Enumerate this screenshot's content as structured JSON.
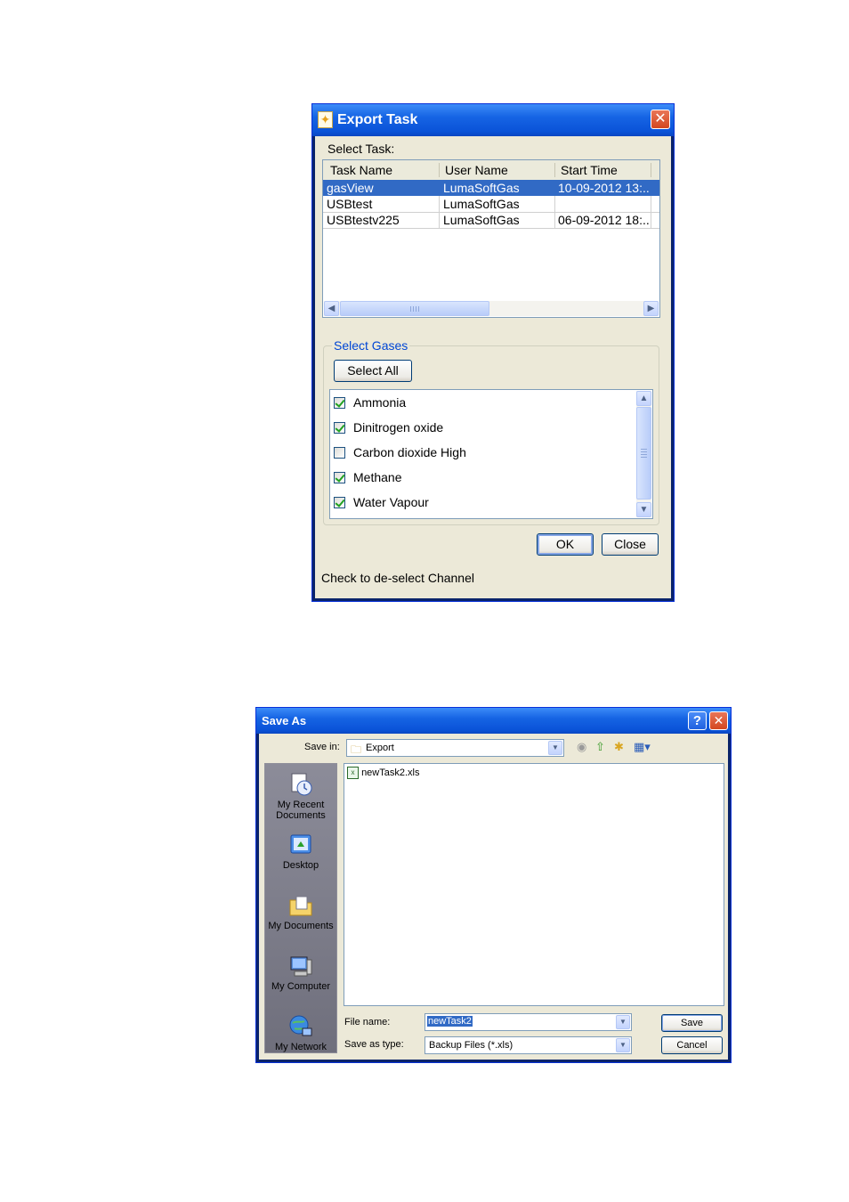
{
  "export_dialog": {
    "title": "Export Task",
    "select_task_label": "Select Task:",
    "columns": [
      "Task Name",
      "User Name",
      "Start Time"
    ],
    "tasks": [
      {
        "name": "gasView",
        "user": "LumaSoftGas",
        "start": "10-09-2012 13:...",
        "selected": true
      },
      {
        "name": "USBtest",
        "user": "LumaSoftGas",
        "start": "",
        "selected": false
      },
      {
        "name": "USBtestv225",
        "user": "LumaSoftGas",
        "start": "06-09-2012 18:...",
        "selected": false
      }
    ],
    "gases_group": "Select Gases",
    "select_all_label": "Select All",
    "gases": [
      {
        "label": "Ammonia",
        "checked": true
      },
      {
        "label": "Dinitrogen oxide",
        "checked": true
      },
      {
        "label": "Carbon dioxide High",
        "checked": false
      },
      {
        "label": "Methane",
        "checked": true
      },
      {
        "label": "Water Vapour",
        "checked": true
      }
    ],
    "ok_label": "OK",
    "close_label": "Close",
    "status_text": "Check to de-select Channel"
  },
  "save_dialog": {
    "title": "Save As",
    "save_in_label": "Save in:",
    "save_in_value": "Export",
    "places": [
      "My Recent\nDocuments",
      "Desktop",
      "My Documents",
      "My Computer",
      "My Network"
    ],
    "files": [
      "newTask2.xls"
    ],
    "file_name_label": "File name:",
    "file_name_value": "newTask2",
    "save_type_label": "Save as type:",
    "save_type_value": "Backup Files (*.xls)",
    "save_label": "Save",
    "cancel_label": "Cancel"
  },
  "colors": {
    "title_blue": "#0a53d8",
    "selection": "#316ac5",
    "dialog_bg": "#ece9d8",
    "close_red": "#d3471f"
  }
}
